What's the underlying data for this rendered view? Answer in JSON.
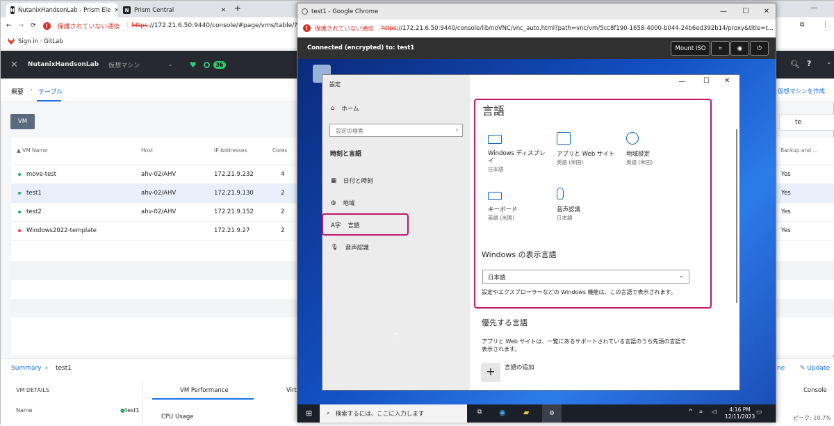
{
  "browser": {
    "tabs": [
      {
        "title": "NutanixHandsonLab - Prism Ele",
        "close": "✕"
      },
      {
        "title": "Prism Central",
        "close": "✕"
      }
    ],
    "new_tab": "+",
    "insecure_label": "保護されていない通信",
    "url_scheme": "https",
    "url_rest": "://172.21.6.50:9440/console/#page/vms/table/?action",
    "bookmark": "Sign in · GitLab"
  },
  "prism": {
    "cluster_name": "NutanixHandsonLab",
    "section": "仮想マシン",
    "alert_count": "36",
    "nav_overview": "概要",
    "nav_table": "テーブル",
    "create_vm": "仮想マシンを作成",
    "vm_button": "VM",
    "filter_value": "te",
    "columns": {
      "name": "VM Name",
      "host": "Host",
      "ip": "IP Addresses",
      "cores": "Cores",
      "backup": "Backup and ..."
    },
    "rows": [
      {
        "name": "move-test",
        "host": "ahv-02/AHV",
        "ip": "172.21.9.232",
        "cores": "4",
        "backup": "Yes",
        "status": "on"
      },
      {
        "name": "test1",
        "host": "ahv-02/AHV",
        "ip": "172.21.9.130",
        "cores": "2",
        "backup": "Yes",
        "status": "on"
      },
      {
        "name": "test2",
        "host": "ahv-02/AHV",
        "ip": "172.21.9.152",
        "cores": "2",
        "backup": "Yes",
        "status": "on"
      },
      {
        "name": "Windows2022-template",
        "host": "",
        "ip": "172.21.9.27",
        "cores": "2",
        "backup": "Yes",
        "status": "off"
      }
    ],
    "breadcrumb_summary": "Summary",
    "breadcrumb_sep": "›",
    "breadcrumb_vm": "test1",
    "vm_details": "VM DETAILS",
    "detail_name_label": "Name",
    "detail_name_value": "test1",
    "tab_perf": "VM Performance",
    "tab_virt": "Virtu",
    "cpu_usage": "CPU Usage",
    "update": "Update",
    "console": "Console",
    "peak": "ピーク: 10.7%",
    "right_e": "ne",
    "color_on": "#27ae60",
    "color_off": "#e53935"
  },
  "vnc": {
    "window_title": "test1 - Google Chrome",
    "insecure_label": "保護されていない通信",
    "url_scheme": "https",
    "url_rest": "://172.21.6.50:9440/console/lib/noVNC/vnc_auto.html?path=vnc/vm/5cc8f190-1658-4000-b044-24b6ed392b14/proxy&title=t...",
    "status": "Connected (encrypted) to: test1",
    "mount_iso": "Mount ISO"
  },
  "settings": {
    "title": "設定",
    "home": "ホーム",
    "search_placeholder": "設定の検索",
    "category": "時刻と言語",
    "nav": [
      "日付と時刻",
      "地域",
      "言語",
      "音声認識"
    ],
    "heading": "言語",
    "tiles": [
      {
        "label": "Windows ディスプレイ",
        "sub": "日本語"
      },
      {
        "label": "アプリと Web サイト",
        "sub": "英語 (米国)"
      },
      {
        "label": "地域設定",
        "sub": "英語 (米国)"
      },
      {
        "label": "キーボード",
        "sub": "英語 (米国)"
      },
      {
        "label": "音声認識",
        "sub": "日本語"
      }
    ],
    "display_lang_heading": "Windows の表示言語",
    "display_lang_value": "日本語",
    "display_lang_note": "設定やエクスプローラーなどの Windows 機能は、この言語で表示されます。",
    "preferred_heading": "優先する言語",
    "preferred_note": "アプリと Web サイトは、一覧にあるサポートされている言語のうち先頭の言語で表示されます。",
    "add_lang": "言語の追加",
    "highlight_color": "#c0166c"
  },
  "taskbar": {
    "search": "検索するには、ここに入力します",
    "time": "4:16 PM",
    "date": "12/11/2023"
  }
}
